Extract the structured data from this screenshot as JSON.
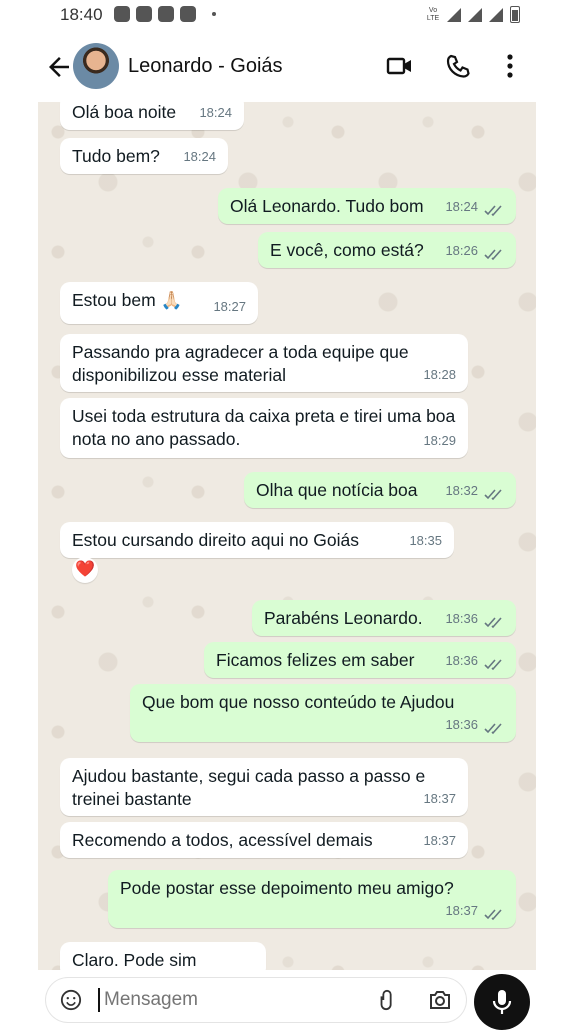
{
  "status_bar": {
    "time": "18:40",
    "network_label": "Vo LTE"
  },
  "header": {
    "contact_name": "Leonardo - Goiás"
  },
  "messages": [
    {
      "dir": "in",
      "text": "Olá boa noite",
      "time": "18:24"
    },
    {
      "dir": "in",
      "text": "Tudo bem?",
      "time": "18:24"
    },
    {
      "dir": "out",
      "text": "Olá Leonardo. Tudo bom",
      "time": "18:24"
    },
    {
      "dir": "out",
      "text": "E você, como está?",
      "time": "18:26"
    },
    {
      "dir": "in",
      "text": "Estou bem 🙏🏻",
      "time": "18:27"
    },
    {
      "dir": "in",
      "text": "Passando pra agradecer a toda equipe que disponibilizou esse material",
      "time": "18:28"
    },
    {
      "dir": "in",
      "text": "Usei toda estrutura da caixa preta e tirei uma boa nota no ano passado.",
      "time": "18:29"
    },
    {
      "dir": "out",
      "text": "Olha que notícia boa",
      "time": "18:32"
    },
    {
      "dir": "in",
      "text": "Estou cursando direito aqui no Goiás",
      "time": "18:35",
      "reaction": "❤️"
    },
    {
      "dir": "out",
      "text": "Parabéns Leonardo.",
      "time": "18:36"
    },
    {
      "dir": "out",
      "text": "Ficamos felizes em saber",
      "time": "18:36"
    },
    {
      "dir": "out",
      "text": "Que bom que nosso conteúdo te Ajudou",
      "time": "18:36"
    },
    {
      "dir": "in",
      "text": "Ajudou bastante, segui cada passo a passo e treinei bastante",
      "time": "18:37"
    },
    {
      "dir": "in",
      "text": "Recomendo a todos, acessível demais",
      "time": "18:37"
    },
    {
      "dir": "out",
      "text": "Pode postar esse depoimento meu amigo?",
      "time": "18:37"
    },
    {
      "dir": "in",
      "text": "Claro. Pode sim",
      "time": ""
    }
  ],
  "composer": {
    "placeholder": "Mensagem"
  },
  "colors": {
    "incoming": "#ffffff",
    "outgoing": "#d9fdd3",
    "read_ticks": "#667781",
    "chat_bg": "#efeae2"
  }
}
